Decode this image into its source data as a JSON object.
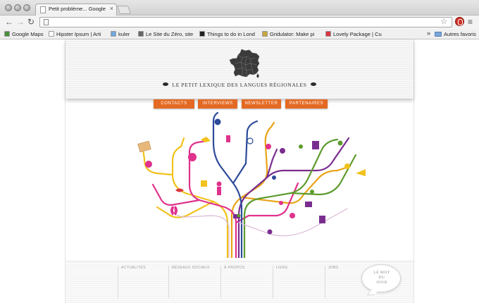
{
  "browser": {
    "tab_title": "Petit problème... Google Ch",
    "tab_close": "×",
    "address_value": "",
    "bookmarks": [
      {
        "label": "Google Maps",
        "icon": "google-maps-icon",
        "color": "#4a8f3a"
      },
      {
        "label": "Hipster Ipsum | Arti",
        "icon": "page-icon",
        "color": "#ffffff"
      },
      {
        "label": "kuler",
        "icon": "kuler-icon",
        "color": "#6fa8dc"
      },
      {
        "label": "Le Site du Zéro, site",
        "icon": "siteduzero-icon",
        "color": "#666666"
      },
      {
        "label": "Things to do in Lond",
        "icon": "flag-icon",
        "color": "#222222"
      },
      {
        "label": "Gridulator: Make pi",
        "icon": "gridulator-icon",
        "color": "#c8a640"
      },
      {
        "label": "Lovely Package | Cu",
        "icon": "heart-icon",
        "color": "#d9363e"
      }
    ],
    "more_label": "»",
    "other_bookmarks": "Autres favoris"
  },
  "site": {
    "title": "LE PETIT LEXIQUE DES LANGUES RÉGIONALES",
    "nav": [
      "CONTACTS",
      "INTERVIEWS",
      "NEWSLETTER",
      "PARTENAIRES"
    ],
    "footer_columns": [
      "ACTUALITÉS",
      "RÉSEAUX SOCIAUX",
      "À PROPOS",
      "LIENS",
      "JOBS"
    ],
    "mot_du_jour": "LE MOT\nDU\nJOUR"
  },
  "colors": {
    "nav_orange": "#e46a23",
    "branches": [
      "#f1c21b",
      "#e8a317",
      "#e0318c",
      "#7a2d8f",
      "#2d4a9b",
      "#5e9b2e"
    ]
  }
}
